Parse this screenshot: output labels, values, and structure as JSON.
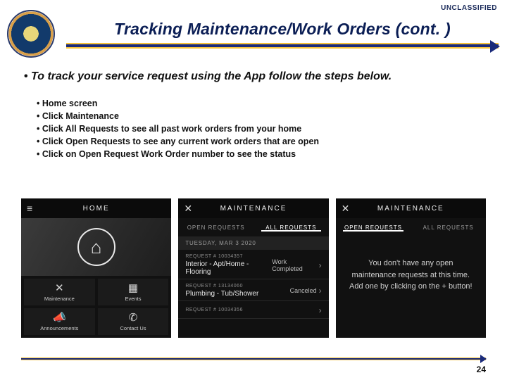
{
  "classification": "UNCLASSIFIED",
  "title": "Tracking Maintenance/Work Orders (cont. )",
  "lead": "To track your service request using the App follow the steps below.",
  "steps": [
    "Home screen",
    "Click Maintenance",
    "Click All Requests to see all past work orders from your home",
    "Click Open Requests to see any current work orders that are open",
    "Click on Open Request Work Order number to see the status"
  ],
  "phone1": {
    "header": "HOME",
    "menu_icon": "≡",
    "house_icon": "⌂",
    "tiles": [
      {
        "icon": "✕",
        "sub_icon": "",
        "label": "Maintenance",
        "name": "tile-maintenance"
      },
      {
        "icon": "▦",
        "sub_icon": "",
        "label": "Events",
        "name": "tile-events"
      },
      {
        "icon": "📣",
        "sub_icon": "",
        "label": "Announcements",
        "name": "tile-announcements"
      },
      {
        "icon": "✆",
        "sub_icon": "",
        "label": "Contact Us",
        "name": "tile-contact-us"
      }
    ]
  },
  "phone2": {
    "header": "MAINTENANCE",
    "close_icon": "✕",
    "tabs": {
      "open": "OPEN REQUESTS",
      "all": "ALL REQUESTS",
      "active": "all"
    },
    "date_section": "TUESDAY, MAR 3 2020",
    "rows": [
      {
        "req": "REQUEST # 10034357",
        "name": "Interior - Apt/Home - Flooring",
        "status": "Work Completed"
      },
      {
        "req": "REQUEST # 13134060",
        "name": "Plumbing - Tub/Shower",
        "status": "Canceled"
      },
      {
        "req": "REQUEST # 10034356",
        "name": "",
        "status": ""
      }
    ]
  },
  "phone3": {
    "header": "MAINTENANCE",
    "close_icon": "✕",
    "tabs": {
      "open": "OPEN REQUESTS",
      "all": "ALL REQUESTS",
      "active": "open"
    },
    "empty_msg": "You don't have any open maintenance requests at this time. Add one by clicking on the + button!"
  },
  "page_number": "24"
}
